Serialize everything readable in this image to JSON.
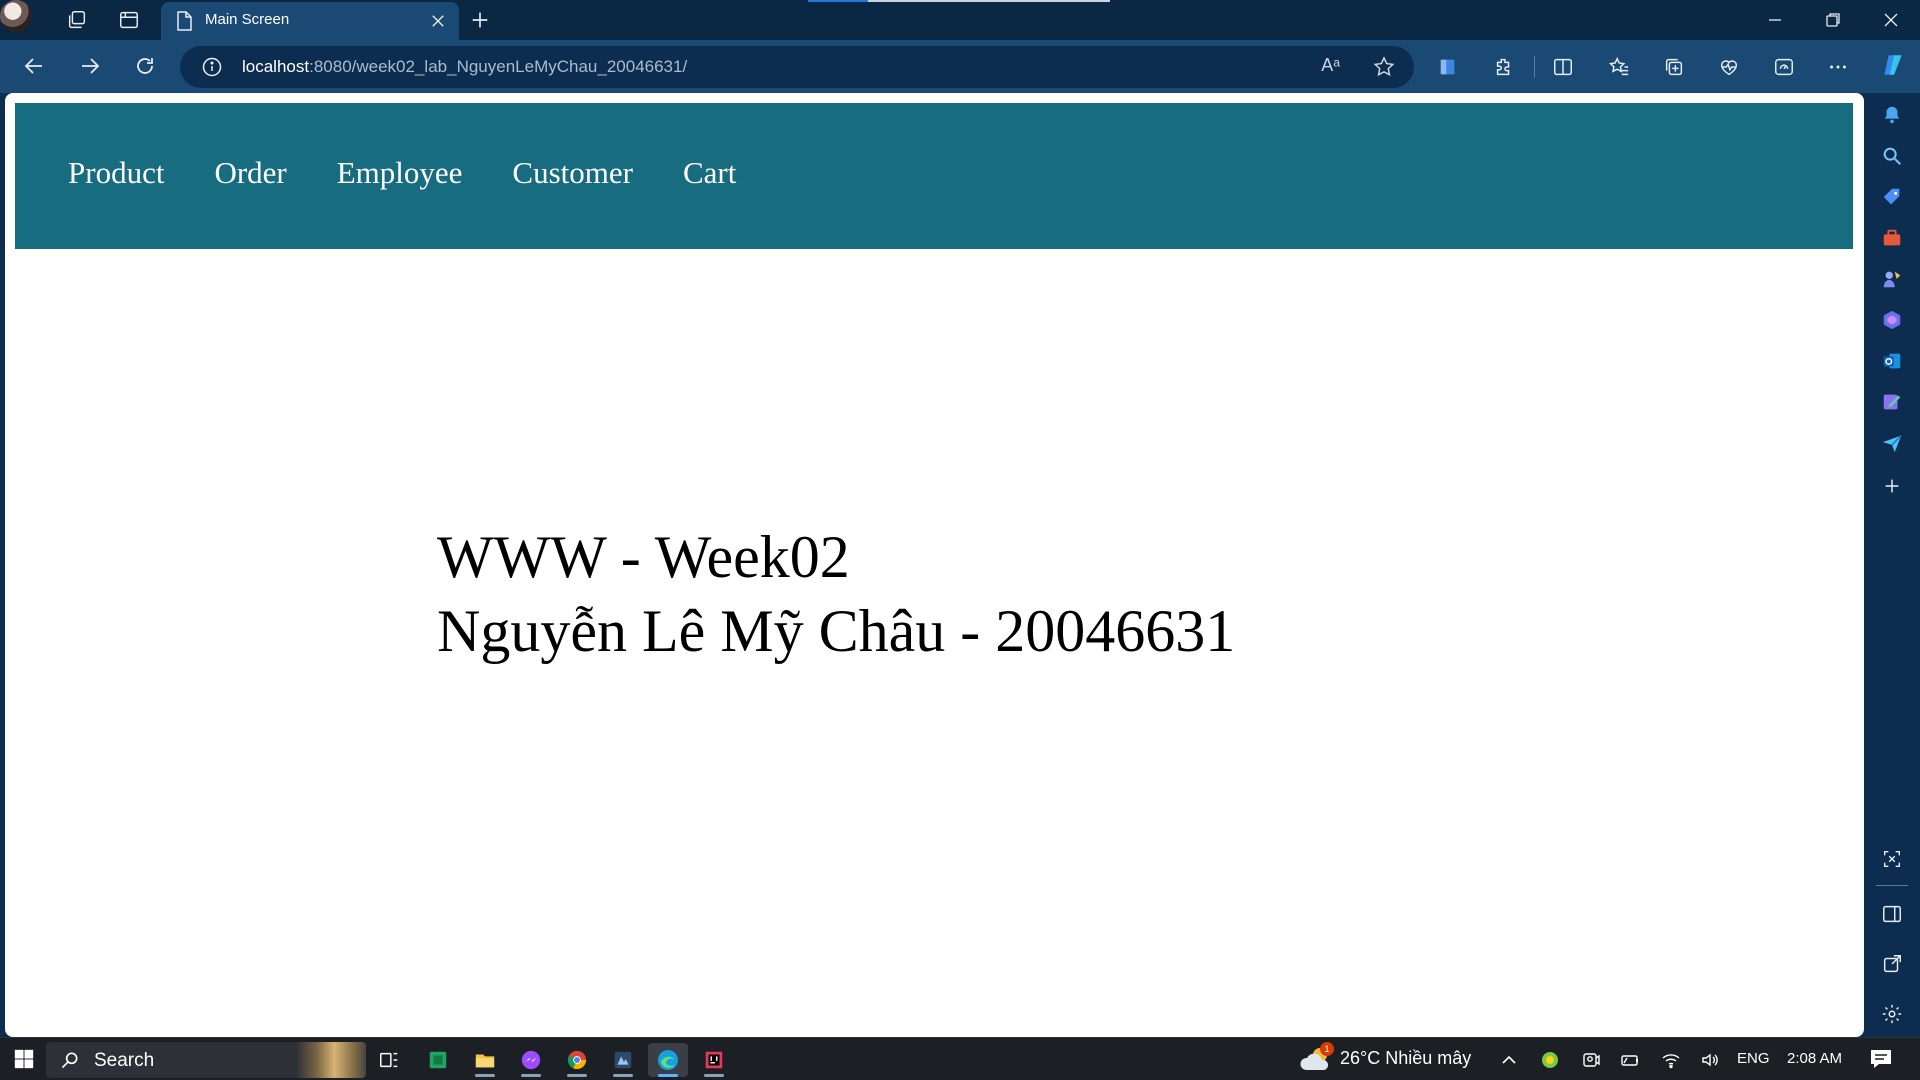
{
  "browser": {
    "tab": {
      "title": "Main Screen"
    },
    "url": {
      "host": "localhost",
      "path": ":8080/week02_lab_NguyenLeMyChau_20046631/"
    },
    "read_aloud_glyph": "Aᵃ"
  },
  "page": {
    "nav": {
      "items": [
        {
          "label": "Product"
        },
        {
          "label": "Order"
        },
        {
          "label": "Employee"
        },
        {
          "label": "Customer"
        },
        {
          "label": "Cart"
        }
      ]
    },
    "hero": {
      "line1": "WWW - Week02",
      "line2": "Nguyễn Lê Mỹ Châu - 20046631"
    },
    "colors": {
      "header_bg": "#186c80",
      "browser_chrome": "#1a4a74",
      "taskbar": "#1c1f24"
    }
  },
  "taskbar": {
    "search_label": "Search",
    "weather": {
      "temp": "26°C",
      "condition": "Nhiều mây",
      "badge": "1"
    },
    "language": "ENG",
    "time": "2:08 AM"
  }
}
